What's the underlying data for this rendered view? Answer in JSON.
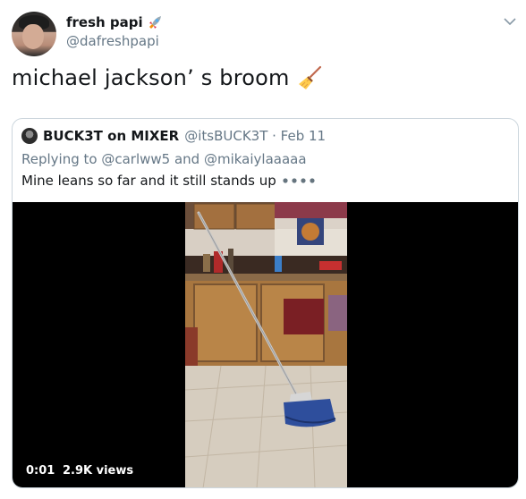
{
  "author": {
    "display_name": "fresh papi",
    "display_name_emoji": "rocket-icon",
    "handle": "@dafreshpapi"
  },
  "tweet": {
    "text": "michael jackson’   s broom",
    "emoji": "broom-icon"
  },
  "quoted_tweet": {
    "display_name": "BUCK3T on MIXER",
    "handle_date": "@itsBUCK3T · Feb 11",
    "reply_prefix": "Replying to ",
    "mention_1": "@carlww5",
    "reply_and": " and ",
    "mention_2": "@mikaiylaaaaa",
    "text": "Mine leans so far and it still stands up",
    "text_emoji": "dots-icon",
    "video": {
      "duration": "0:01",
      "views": "2.9K views"
    }
  },
  "colors": {
    "text_primary": "#14171a",
    "text_secondary": "#657786",
    "border": "#ccd6dd",
    "video_bg": "#000000"
  }
}
